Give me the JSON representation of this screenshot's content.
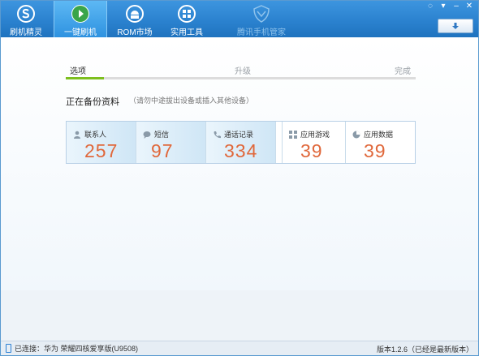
{
  "toolbar": {
    "items": [
      {
        "label": "刷机精灵",
        "icon": "s-logo-icon"
      },
      {
        "label": "一键刷机",
        "icon": "play-icon"
      },
      {
        "label": "ROM市场",
        "icon": "android-icon"
      },
      {
        "label": "实用工具",
        "icon": "grid-icon"
      },
      {
        "label": "腾讯手机管家",
        "icon": "shield-icon"
      }
    ],
    "refresh_icon": "arrow-down-icon"
  },
  "steps": [
    {
      "label": "选项",
      "active": true
    },
    {
      "label": "升级",
      "active": false
    },
    {
      "label": "完成",
      "active": false
    }
  ],
  "progress_fraction": 0.11,
  "backup": {
    "title": "正在备份资料",
    "hint": "（请勿中途拔出设备或插入其他设备）",
    "cards": [
      {
        "label": "联系人",
        "value": "257",
        "icon": "person-icon"
      },
      {
        "label": "短信",
        "value": "97",
        "icon": "message-icon"
      },
      {
        "label": "通话记录",
        "value": "334",
        "icon": "phone-icon"
      },
      {
        "label": "应用游戏",
        "value": "39",
        "icon": "apps-icon"
      },
      {
        "label": "应用数据",
        "value": "39",
        "icon": "pie-icon"
      }
    ]
  },
  "status": {
    "connection": "已连接：华为 荣耀四核爱享版(U9508)",
    "version": "版本1.2.6（已经是最新版本）"
  },
  "colors": {
    "toolbar": "#2b82cf",
    "progress": "#7dbf1e",
    "count": "#e0683b"
  }
}
